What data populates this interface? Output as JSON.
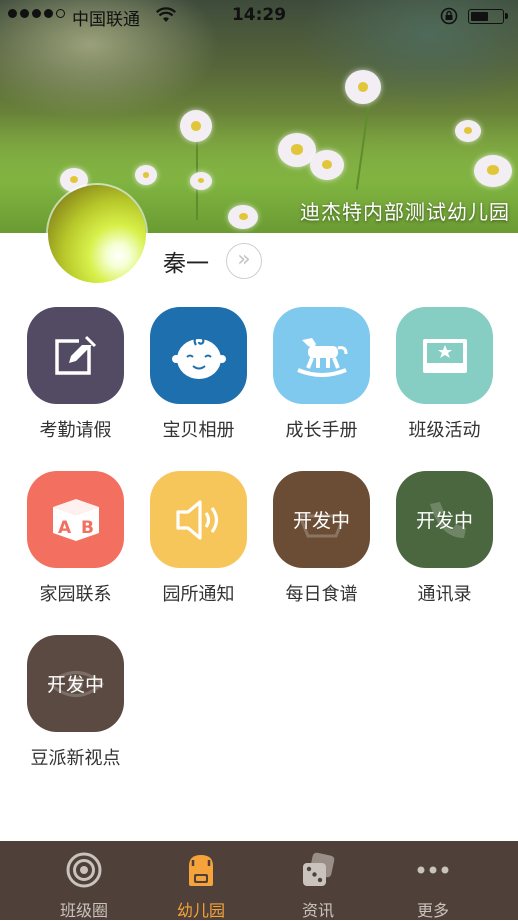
{
  "status_bar": {
    "carrier": "中国联通",
    "time": "14:29",
    "signal_dots_filled": 4,
    "signal_dots_total": 5,
    "battery_level_percent": 60
  },
  "header": {
    "school_name": "迪杰特内部测试幼儿园"
  },
  "profile": {
    "name": "秦一",
    "arrow_glyph": "»"
  },
  "menu": {
    "items": [
      {
        "label": "考勤请假",
        "icon": "edit-icon",
        "color": "#534a63",
        "badge": ""
      },
      {
        "label": "宝贝相册",
        "icon": "baby-face-icon",
        "color": "#1d6fae",
        "badge": ""
      },
      {
        "label": "成长手册",
        "icon": "rocking-horse-icon",
        "color": "#7fc9ee",
        "badge": ""
      },
      {
        "label": "班级活动",
        "icon": "photo-frame-icon",
        "color": "#86cdc3",
        "badge": ""
      },
      {
        "label": "家园联系",
        "icon": "ab-block-icon",
        "color": "#f36f5f",
        "badge": ""
      },
      {
        "label": "园所通知",
        "icon": "speaker-icon",
        "color": "#f7c65a",
        "badge": ""
      },
      {
        "label": "每日食谱",
        "icon": "food-icon",
        "color": "#6b4d35",
        "badge": "开发中"
      },
      {
        "label": "通讯录",
        "icon": "phone-icon",
        "color": "#4b6740",
        "badge": "开发中"
      },
      {
        "label": "豆派新视点",
        "icon": "eye-icon",
        "color": "#5b4a41",
        "badge": "开发中"
      }
    ]
  },
  "tabbar": {
    "tabs": [
      {
        "label": "班级圈",
        "icon": "target-icon",
        "active": false
      },
      {
        "label": "幼儿园",
        "icon": "school-bag-icon",
        "active": true
      },
      {
        "label": "资讯",
        "icon": "dice-icon",
        "active": false
      },
      {
        "label": "更多",
        "icon": "more-dots-icon",
        "active": false
      }
    ],
    "active_color": "#f5a33a",
    "inactive_color": "#c9c2bd"
  }
}
